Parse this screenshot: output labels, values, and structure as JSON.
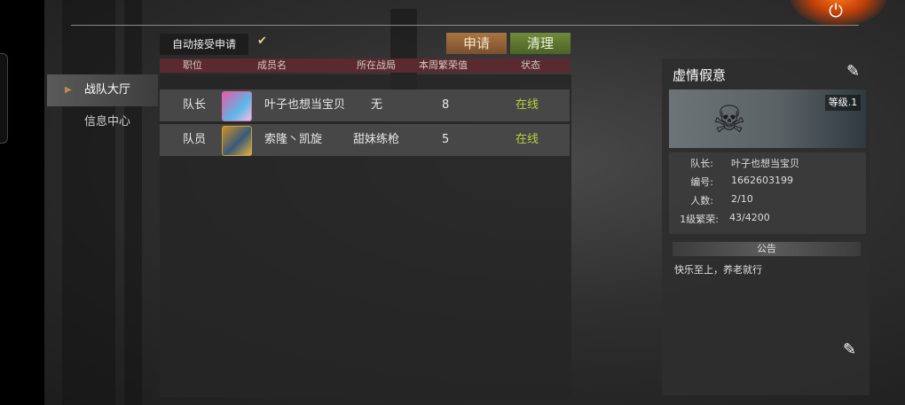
{
  "sidebar": {
    "items": [
      {
        "label": "战队大厅",
        "active": true
      },
      {
        "label": "信息中心",
        "active": false
      }
    ]
  },
  "toolbar": {
    "auto_accept_label": "自动接受申请",
    "auto_accept_checked": true,
    "apply_label": "申请",
    "clear_label": "清理"
  },
  "table": {
    "headers": [
      "职位",
      "成员名",
      "所在战局",
      "本周繁荣值",
      "状态"
    ],
    "rows": [
      {
        "role": "队长",
        "name": "叶子也想当宝贝",
        "match": "无",
        "prosperity": "8",
        "status": "在线"
      },
      {
        "role": "队员",
        "name": "索隆丶凯旋",
        "match": "甜妹练枪",
        "prosperity": "5",
        "status": "在线"
      }
    ]
  },
  "team": {
    "name": "虚情假意",
    "level": "等级.1",
    "fields": [
      {
        "label": "队长:",
        "value": "叶子也想当宝贝"
      },
      {
        "label": "编号:",
        "value": "1662603199"
      },
      {
        "label": "人数:",
        "value": "2/10"
      },
      {
        "label": "1级繁荣:",
        "value": "43/4200"
      }
    ],
    "notice_title": "公告",
    "notice_text": "快乐至上，养老就行"
  },
  "colors": {
    "apply": "#a97442",
    "clear": "#6f8a3a",
    "online": "#b6d23a",
    "header": "#5a2a2e"
  }
}
